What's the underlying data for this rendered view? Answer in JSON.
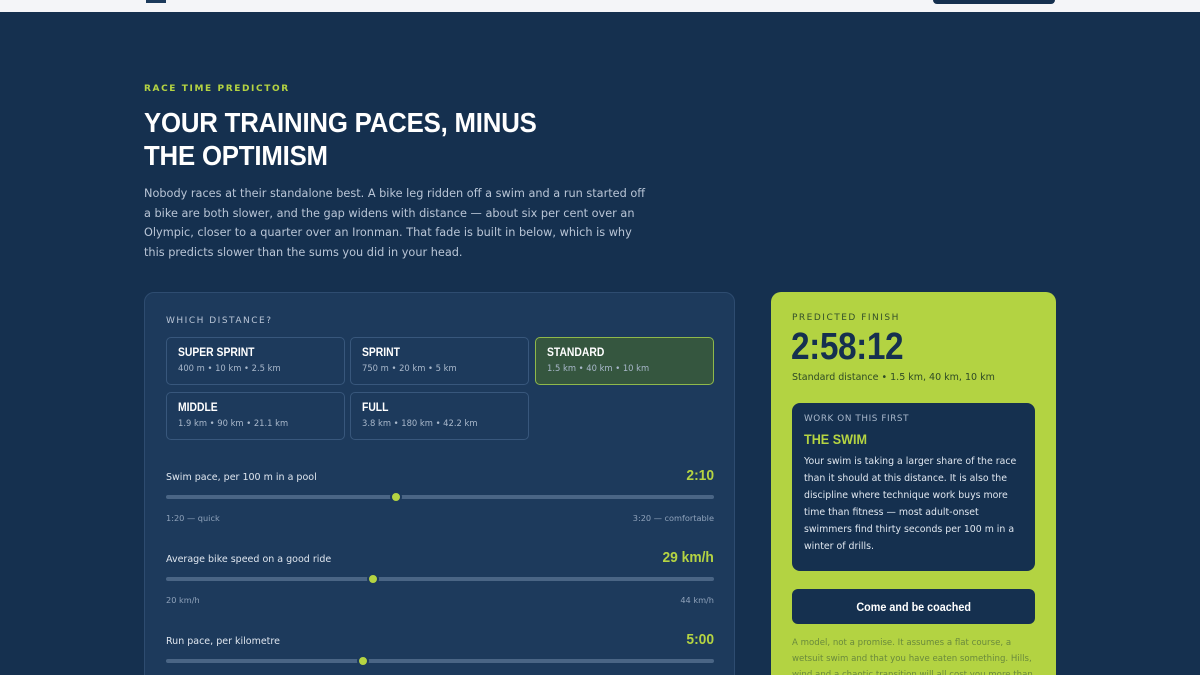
{
  "hero": {
    "eyebrow": "Race time predictor",
    "headline": "Your training paces, minus the optimism",
    "lede": "Nobody races at their standalone best. A bike leg ridden off a swim and a run started off a bike are both slower, and the gap widens with distance — about six per cent over an Olympic, closer to a quarter over an Ironman. That fade is built in below, which is why this predicts slower than the sums you did in your head."
  },
  "calculator": {
    "distance_label": "Which distance?",
    "options": [
      {
        "name": "Super Sprint",
        "sub": "400 m • 10 km • 2.5 km",
        "selected": false
      },
      {
        "name": "Sprint",
        "sub": "750 m • 20 km • 5 km",
        "selected": false
      },
      {
        "name": "Standard",
        "sub": "1.5 km • 40 km • 10 km",
        "selected": true
      },
      {
        "name": "Middle",
        "sub": "1.9 km • 90 km • 21.1 km",
        "selected": false
      },
      {
        "name": "Full",
        "sub": "3.8 km • 180 km • 42.2 km",
        "selected": false
      }
    ],
    "sliders": [
      {
        "label": "Swim pace, per 100 m in a pool",
        "value": "2:10",
        "min": "1:20 — quick",
        "max": "3:20 — comfortable",
        "fraction": 0.42
      },
      {
        "label": "Average bike speed on a good ride",
        "value": "29 km/h",
        "min": "20 km/h",
        "max": "44 km/h",
        "fraction": 0.378
      },
      {
        "label": "Run pace, per kilometre",
        "value": "5:00",
        "min": "",
        "max": "",
        "fraction": 0.36
      }
    ]
  },
  "result": {
    "eyebrow": "Predicted finish",
    "time": "2:58:12",
    "distance_line": "Standard distance • 1.5 km, 40 km, 10 km",
    "focus": {
      "eyebrow": "Work on this first",
      "title": "The swim",
      "body": "Your swim is taking a larger share of the race than it should at this distance. It is also the discipline where technique work buys more time than fitness — most adult-onset swimmers find thirty seconds per 100 m in a winter of drills."
    },
    "cta_label": "Come and be coached",
    "disclaimer": "A model, not a promise. It assumes a flat course, a wetsuit swim and that you have eaten something. Hills, wind and a chaotic transition will all cost you more than the arithmetic"
  },
  "colors": {
    "background": "#15304f",
    "accent": "#b5d442",
    "panel": "#1d3a5c"
  }
}
